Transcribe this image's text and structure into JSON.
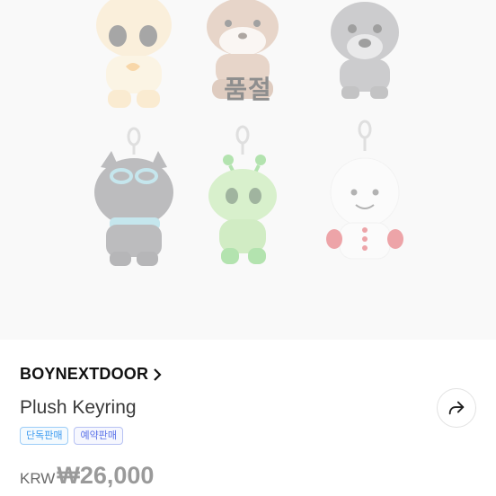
{
  "product_image": {
    "status_label": "품절",
    "items": [
      {
        "icon": "cat-plush-keyring"
      },
      {
        "icon": "otter-plush-keyring"
      },
      {
        "icon": "dog-plush-keyring"
      },
      {
        "icon": "grey-cat-plush-keyring"
      },
      {
        "icon": "alien-plush-keyring"
      },
      {
        "icon": "white-plush-keyring"
      }
    ]
  },
  "product": {
    "brand": "BOYNEXTDOOR",
    "name": "Plush Keyring",
    "badges": {
      "exclusive": "단독판매",
      "preorder": "예약판매"
    },
    "currency": "KRW",
    "price": "₩26,000"
  },
  "colors": {
    "image_bg": "#f1f1f1",
    "exclusive_badge": "#3d9bf0",
    "preorder_badge": "#5a72e8"
  }
}
